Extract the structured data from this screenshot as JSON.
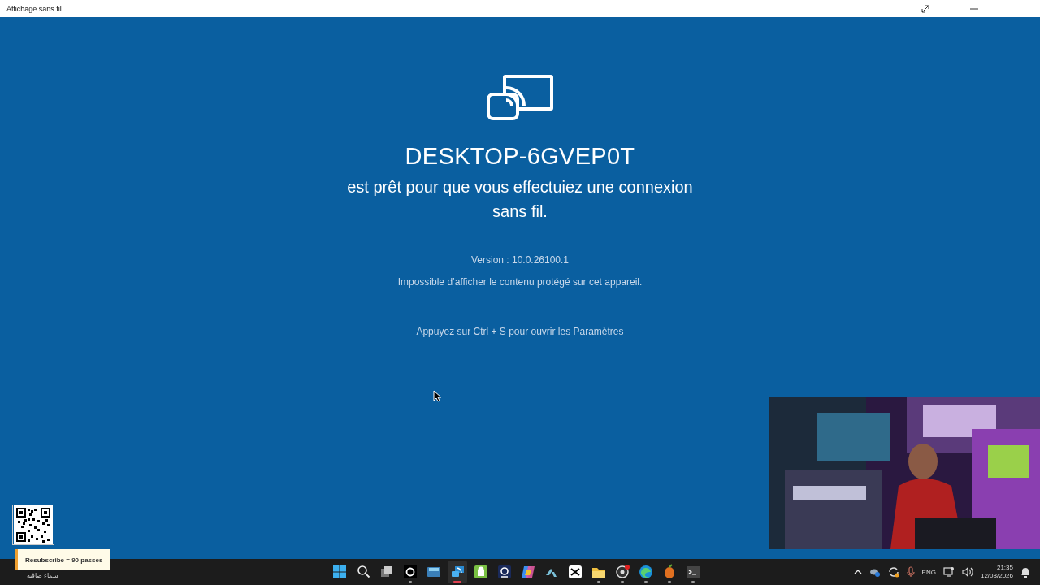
{
  "window": {
    "title": "Affichage sans fil"
  },
  "main": {
    "device_name": "DESKTOP-6GVEP0T",
    "message": "est prêt pour que vous effectuiez une connexion sans fil.",
    "version": "Version : 10.0.26100.1",
    "protection_note": "Impossible d’afficher le contenu protégé sur cet appareil.",
    "settings_hint": "Appuyez sur Ctrl + S pour ouvrir les Paramètres"
  },
  "overlay": {
    "qr": true,
    "badge": "Resubscribe = 90 passes"
  },
  "taskbar": {
    "weather": "سماء صافية",
    "apps": [
      {
        "kind": "start",
        "selected": false,
        "running": false
      },
      {
        "kind": "search",
        "selected": false,
        "running": false
      },
      {
        "kind": "taskview",
        "selected": false,
        "running": false
      },
      {
        "kind": "app-dark",
        "selected": false,
        "running": true
      },
      {
        "kind": "keyboard",
        "selected": false,
        "running": false
      },
      {
        "kind": "cast",
        "selected": true,
        "running": true
      },
      {
        "kind": "android",
        "selected": false,
        "running": false
      },
      {
        "kind": "webcam",
        "selected": false,
        "running": false
      },
      {
        "kind": "copilot",
        "selected": false,
        "running": false
      },
      {
        "kind": "chevrons",
        "selected": false,
        "running": false
      },
      {
        "kind": "capcut",
        "selected": false,
        "running": false
      },
      {
        "kind": "folder",
        "selected": false,
        "running": true
      },
      {
        "kind": "obs",
        "selected": false,
        "running": true
      },
      {
        "kind": "edge",
        "selected": false,
        "running": true
      },
      {
        "kind": "fl",
        "selected": false,
        "running": true
      },
      {
        "kind": "terminal",
        "selected": false,
        "running": true
      }
    ],
    "tray": {
      "language": "ENG",
      "time": "21:35",
      "date": "12/08/2026"
    }
  }
}
